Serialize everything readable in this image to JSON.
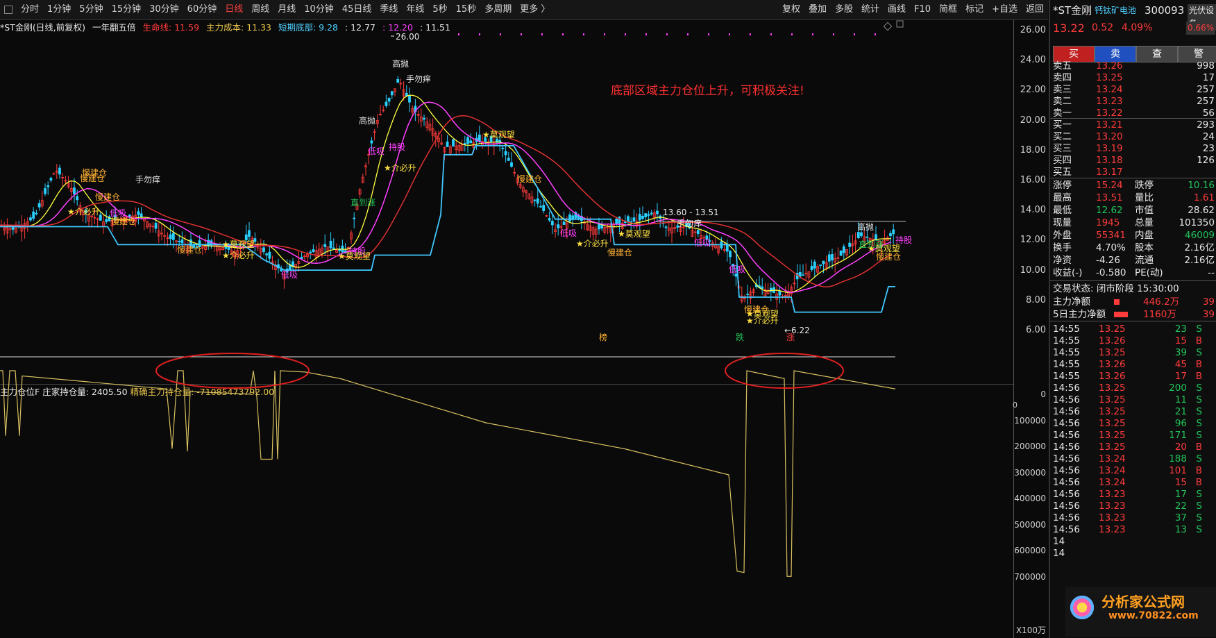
{
  "toolbar": {
    "periods": [
      "分时",
      "1分钟",
      "5分钟",
      "15分钟",
      "30分钟",
      "60分钟",
      "日线",
      "周线",
      "月线",
      "10分钟",
      "45日线",
      "季线",
      "年线",
      "5秒",
      "15秒",
      "多周期",
      "更多 〉"
    ],
    "active": "日线",
    "tools": [
      "复权",
      "叠加",
      "多股",
      "统计",
      "画线",
      "F10",
      "简框",
      "标记",
      "+自选",
      "返回"
    ]
  },
  "info": {
    "stock": "*ST金刚(日线,前复权)",
    "formula": "一年翻五倍",
    "life_line": "生命线: 11.59",
    "main_cost": "主力成本: 11.33",
    "short_bottom": "短期底部: 9.28",
    "v1": ": 12.77",
    "v2": ": 12.20",
    "v3": ": 11.51"
  },
  "main_axis": [
    "26.00",
    "24.00",
    "22.00",
    "20.00",
    "18.00",
    "16.00",
    "14.00",
    "12.00",
    "10.00",
    "8.00",
    "6.00"
  ],
  "sub_axis": [
    "0",
    "100000",
    "200000",
    "300000",
    "400000",
    "500000",
    "600000",
    "700000",
    "X100万"
  ],
  "sub_zero_left": "0",
  "sub": {
    "name": "主力仓位F",
    "holding": "庄家持仓量: 2405.50",
    "precise": "精确主力持仓量: -71085473792.00"
  },
  "annotation": "底部区域主力仓位上升，可积极关注!",
  "labels": {
    "high_price": "26.00",
    "low_price": "←6.22",
    "range": "13.60 - 13.51",
    "chart_labels": [
      {
        "t": "手勿痒",
        "c": "white"
      },
      {
        "t": "慢建仓",
        "c": "orange"
      },
      {
        "t": "★介必升",
        "c": "yellow"
      },
      {
        "t": "低吸",
        "c": "mag"
      },
      {
        "t": "高抛",
        "c": "white"
      },
      {
        "t": "持股",
        "c": "mag"
      },
      {
        "t": "★莫观望",
        "c": "yellow"
      },
      {
        "t": "直到涨",
        "c": "green"
      },
      {
        "t": "榜",
        "c": "orange"
      },
      {
        "t": "跌",
        "c": "green"
      },
      {
        "t": "涨",
        "c": "red"
      }
    ]
  },
  "quote": {
    "name": "*ST金刚",
    "tag": "钙钛矿电池",
    "code": "300093",
    "price": "13.22",
    "change": "0.52",
    "pct": "4.09%",
    "setting": "光伏设备",
    "setting_pct": "0.66%",
    "buttons": [
      "买",
      "卖",
      "查",
      "警"
    ]
  },
  "orderbook": [
    {
      "l": "卖五",
      "p": "13.26",
      "v": "998"
    },
    {
      "l": "卖四",
      "p": "13.25",
      "v": "17"
    },
    {
      "l": "卖三",
      "p": "13.24",
      "v": "257"
    },
    {
      "l": "卖二",
      "p": "13.23",
      "v": "257"
    },
    {
      "l": "卖一",
      "p": "13.22",
      "v": "56"
    },
    {
      "l": "买一",
      "p": "13.21",
      "v": "293"
    },
    {
      "l": "买二",
      "p": "13.20",
      "v": "24"
    },
    {
      "l": "买三",
      "p": "13.19",
      "v": "23"
    },
    {
      "l": "买四",
      "p": "13.18",
      "v": "126"
    },
    {
      "l": "买五",
      "p": "13.17",
      "v": ""
    }
  ],
  "stats": [
    {
      "a": "涨停",
      "av": "15.24",
      "ac": "red",
      "b": "跌停",
      "bv": "10.16",
      "bc": "green"
    },
    {
      "a": "最高",
      "av": "13.51",
      "ac": "red",
      "b": "量比",
      "bv": "1.61",
      "bc": "red"
    },
    {
      "a": "最低",
      "av": "12.62",
      "ac": "green",
      "b": "市值",
      "bv": "28.62",
      "bc": "white"
    },
    {
      "a": "现量",
      "av": "1945",
      "ac": "red",
      "b": "总量",
      "bv": "101350",
      "bc": "white"
    },
    {
      "a": "外盘",
      "av": "55341",
      "ac": "red",
      "b": "内盘",
      "bv": "46009",
      "bc": "green"
    },
    {
      "a": "换手",
      "av": "4.70%",
      "ac": "white",
      "b": "股本",
      "bv": "2.16亿",
      "bc": "white"
    },
    {
      "a": "净资",
      "av": "-4.26",
      "ac": "white",
      "b": "流通",
      "bv": "2.16亿",
      "bc": "white"
    },
    {
      "a": "收益(-)",
      "av": "-0.580",
      "ac": "white",
      "b": "PE(动)",
      "bv": "--",
      "bc": "white"
    }
  ],
  "trade_status": "交易状态: 闭市阶段 15:30:00",
  "flows": [
    {
      "l": "主力净额",
      "v": "446.2万",
      "r": "39"
    },
    {
      "l": "5日主力净额",
      "v": "1160万",
      "r": "39"
    }
  ],
  "ticks": [
    {
      "t": "14:55",
      "p": "13.25",
      "v": "23",
      "s": "S"
    },
    {
      "t": "14:55",
      "p": "13.26",
      "v": "15",
      "s": "B"
    },
    {
      "t": "14:55",
      "p": "13.25",
      "v": "39",
      "s": "S"
    },
    {
      "t": "14:55",
      "p": "13.26",
      "v": "45",
      "s": "B"
    },
    {
      "t": "14:55",
      "p": "13.26",
      "v": "17",
      "s": "B"
    },
    {
      "t": "14:56",
      "p": "13.25",
      "v": "200",
      "s": "S"
    },
    {
      "t": "14:56",
      "p": "13.25",
      "v": "11",
      "s": "S"
    },
    {
      "t": "14:56",
      "p": "13.25",
      "v": "21",
      "s": "S"
    },
    {
      "t": "14:56",
      "p": "13.25",
      "v": "96",
      "s": "S"
    },
    {
      "t": "14:56",
      "p": "13.25",
      "v": "171",
      "s": "S"
    },
    {
      "t": "14:56",
      "p": "13.25",
      "v": "20",
      "s": "B"
    },
    {
      "t": "14:56",
      "p": "13.24",
      "v": "188",
      "s": "S"
    },
    {
      "t": "14:56",
      "p": "13.24",
      "v": "101",
      "s": "B"
    },
    {
      "t": "14:56",
      "p": "13.24",
      "v": "15",
      "s": "B"
    },
    {
      "t": "14:56",
      "p": "13.23",
      "v": "17",
      "s": "S"
    },
    {
      "t": "14:56",
      "p": "13.23",
      "v": "22",
      "s": "S"
    },
    {
      "t": "14:56",
      "p": "13.23",
      "v": "37",
      "s": "S"
    },
    {
      "t": "14:56",
      "p": "13.23",
      "v": "13",
      "s": "S"
    },
    {
      "t": "14",
      "p": "",
      "v": "",
      "s": ""
    },
    {
      "t": "14",
      "p": "",
      "v": "",
      "s": ""
    }
  ],
  "watermark": "分析家公式网",
  "watermark_url": "www.70822.com"
}
